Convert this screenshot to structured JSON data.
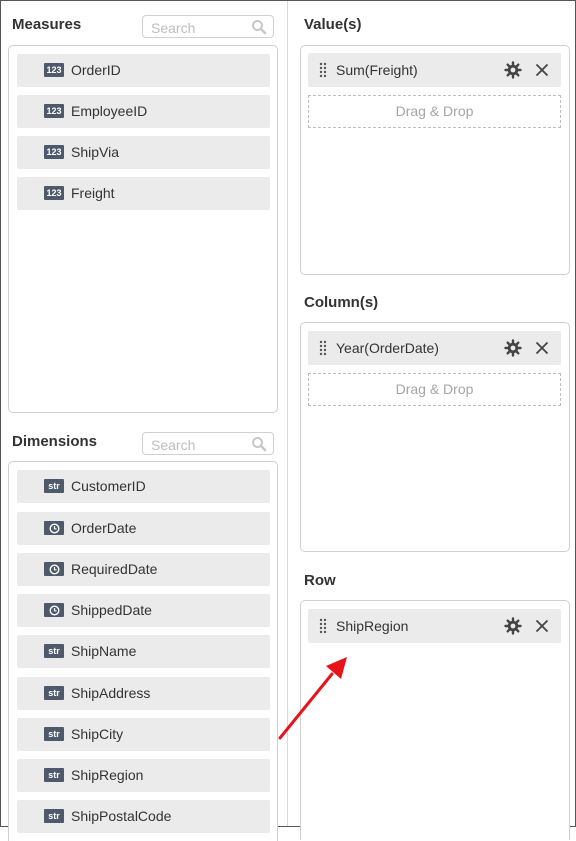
{
  "measures": {
    "title": "Measures",
    "search_placeholder": "Search",
    "items": [
      {
        "type": "123",
        "label": "OrderID"
      },
      {
        "type": "123",
        "label": "EmployeeID"
      },
      {
        "type": "123",
        "label": "ShipVia"
      },
      {
        "type": "123",
        "label": "Freight"
      }
    ]
  },
  "dimensions": {
    "title": "Dimensions",
    "search_placeholder": "Search",
    "items": [
      {
        "type": "str",
        "label": "CustomerID"
      },
      {
        "type": "date",
        "label": "OrderDate"
      },
      {
        "type": "date",
        "label": "RequiredDate"
      },
      {
        "type": "date",
        "label": "ShippedDate"
      },
      {
        "type": "str",
        "label": "ShipName"
      },
      {
        "type": "str",
        "label": "ShipAddress"
      },
      {
        "type": "str",
        "label": "ShipCity"
      },
      {
        "type": "str",
        "label": "ShipRegion"
      },
      {
        "type": "str",
        "label": "ShipPostalCode"
      }
    ]
  },
  "values": {
    "title": "Value(s)",
    "items": [
      {
        "label": "Sum(Freight)"
      }
    ],
    "drop_hint": "Drag & Drop"
  },
  "columns": {
    "title": "Column(s)",
    "items": [
      {
        "label": "Year(OrderDate)"
      }
    ],
    "drop_hint": "Drag & Drop"
  },
  "row": {
    "title": "Row",
    "items": [
      {
        "label": "ShipRegion"
      }
    ]
  },
  "icons": {
    "grip": "drag-handle-icon",
    "settings": "gear-icon",
    "remove": "close-icon",
    "search": "search-icon",
    "date": "clock-icon",
    "annotation": "red-arrow-icon"
  },
  "colors": {
    "badge": "#4e5a6c",
    "item_bg": "#ebebeb",
    "arrow": "#e8141b"
  }
}
